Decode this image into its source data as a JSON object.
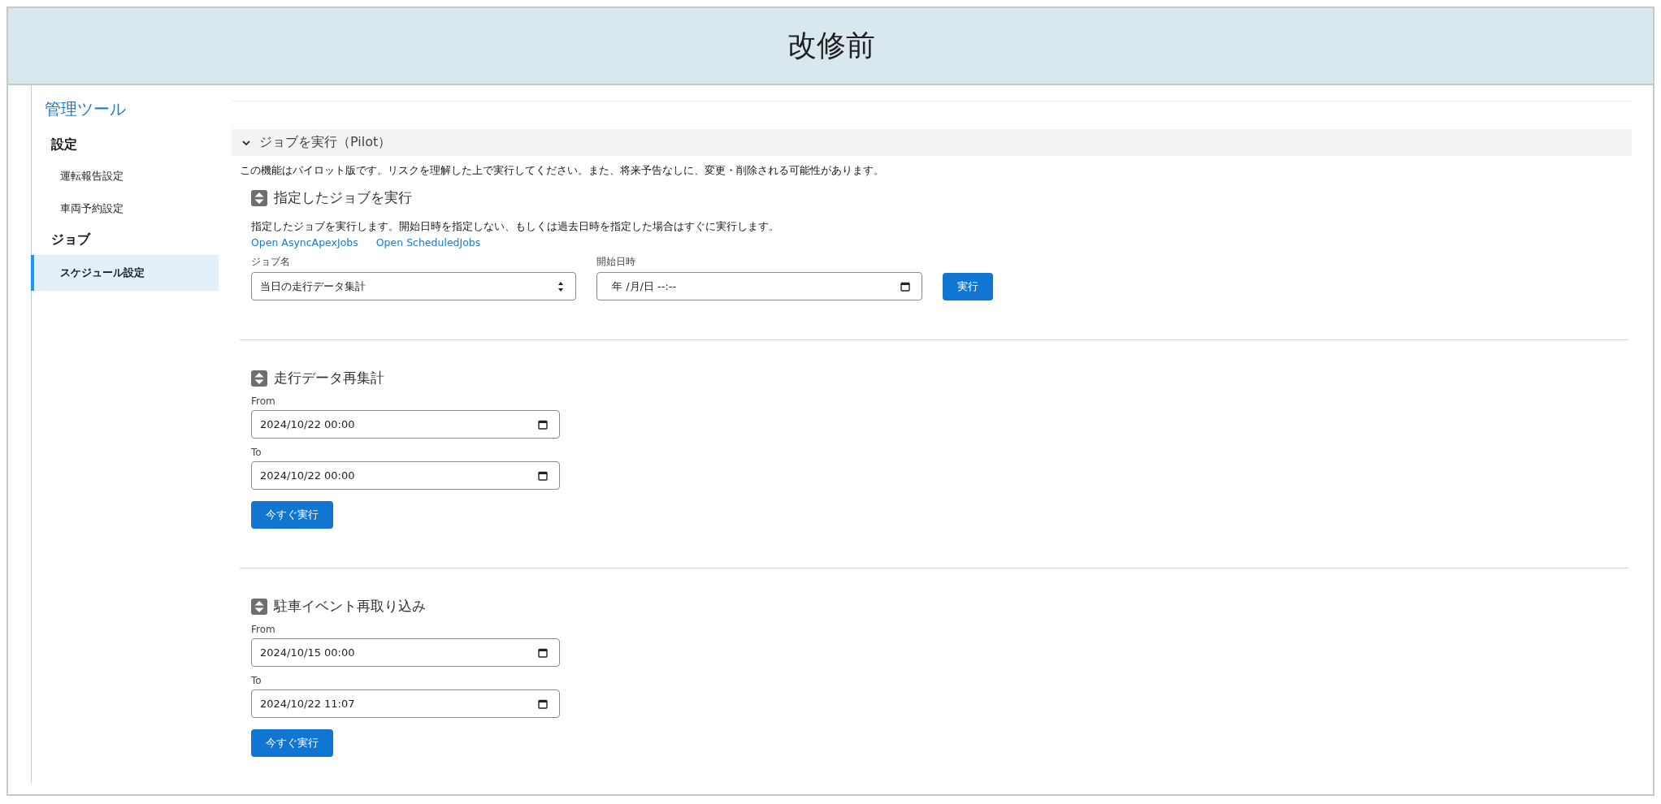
{
  "header": {
    "title": "改修前"
  },
  "sidebar": {
    "title": "管理ツール",
    "groups": [
      {
        "label": "設定",
        "items": [
          {
            "label": "運転報告設定",
            "selected": false
          },
          {
            "label": "車両予約設定",
            "selected": false
          }
        ]
      },
      {
        "label": "ジョブ",
        "items": [
          {
            "label": "スケジュール設定",
            "selected": true
          }
        ]
      }
    ]
  },
  "panel": {
    "title": "ジョブを実行（Pilot）",
    "expanded": true,
    "notice": "この機能はパイロット版です。リスクを理解した上で実行してください。また、将来予告なしに、変更・削除される可能性があります。",
    "sections": [
      {
        "kind": "job",
        "title": "指定したジョブを実行",
        "description": "指定したジョブを実行します。開始日時を指定しない、もしくは過去日時を指定した場合はすぐに実行します。",
        "links": [
          "Open AsyncApexJobs",
          "Open ScheduledJobs"
        ],
        "job_field": {
          "label": "ジョブ名",
          "value": "当日の走行データ集計"
        },
        "start_field": {
          "label": "開始日時",
          "value": "年 /月/日 --:--"
        },
        "button": "実行"
      },
      {
        "kind": "range",
        "title": "走行データ再集計",
        "fields": [
          {
            "label": "From",
            "value": "2024/10/22 00:00"
          },
          {
            "label": "To",
            "value": "2024/10/22 00:00"
          }
        ],
        "button": "今すぐ実行"
      },
      {
        "kind": "range",
        "title": "駐車イベント再取り込み",
        "fields": [
          {
            "label": "From",
            "value": "2024/10/15 00:00"
          },
          {
            "label": "To",
            "value": "2024/10/22 11:07"
          }
        ],
        "button": "今すぐ実行"
      }
    ]
  }
}
